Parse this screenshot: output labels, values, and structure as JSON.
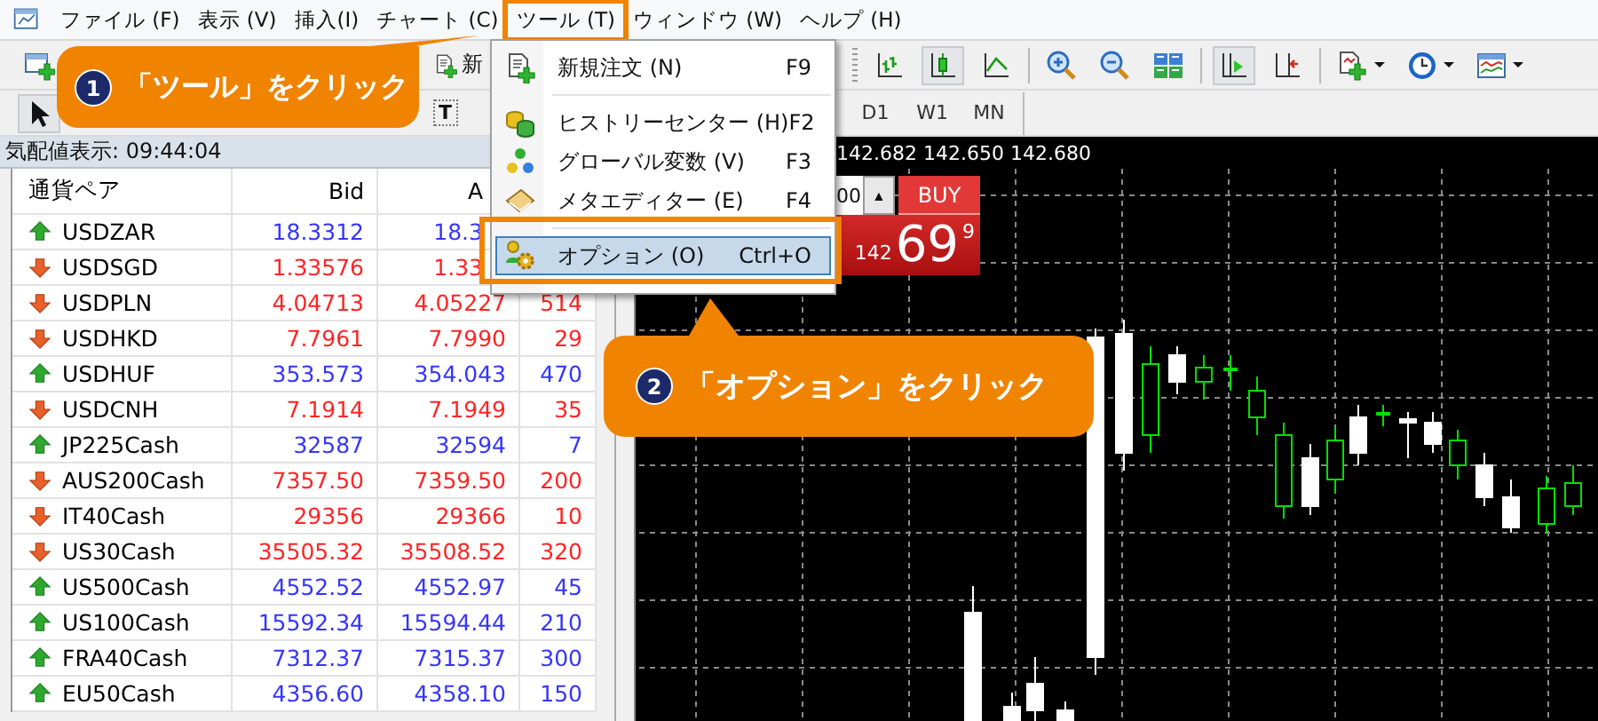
{
  "menubar": {
    "items": [
      {
        "label": "ファイル (F)",
        "highlighted": false
      },
      {
        "label": "表示 (V)",
        "highlighted": false
      },
      {
        "label": "挿入(I)",
        "highlighted": false
      },
      {
        "label": "チャート (C)",
        "highlighted": false
      },
      {
        "label": "ツール (T)",
        "highlighted": true
      },
      {
        "label": "ウィンドウ (W)",
        "highlighted": false
      },
      {
        "label": "ヘルプ (H)",
        "highlighted": false
      }
    ]
  },
  "toolbar": {
    "row1": [
      [
        {
          "kind": "new-chart",
          "pressed": false,
          "dropdown": false
        }
      ],
      [
        {
          "kind": "new-order",
          "pressed": false,
          "dropdown": false,
          "label": "新"
        }
      ],
      [
        {
          "kind": "grip"
        },
        {
          "kind": "bar-chart",
          "pressed": false,
          "dropdown": false
        },
        {
          "kind": "candle-chart",
          "pressed": true,
          "dropdown": false
        },
        {
          "kind": "line-chart",
          "pressed": false,
          "dropdown": false
        },
        {
          "kind": "separator"
        },
        {
          "kind": "zoom-in",
          "pressed": false,
          "dropdown": false
        },
        {
          "kind": "zoom-out",
          "pressed": false,
          "dropdown": false
        },
        {
          "kind": "tile",
          "pressed": false,
          "dropdown": false
        },
        {
          "kind": "separator"
        },
        {
          "kind": "autoscroll",
          "pressed": true,
          "dropdown": false
        },
        {
          "kind": "chart-shift",
          "pressed": false,
          "dropdown": false
        },
        {
          "kind": "separator"
        },
        {
          "kind": "indicator",
          "pressed": false,
          "dropdown": true
        },
        {
          "kind": "clock",
          "pressed": false,
          "dropdown": true
        },
        {
          "kind": "template",
          "pressed": false,
          "dropdown": true
        }
      ]
    ],
    "row2": [
      [
        {
          "kind": "cursor",
          "pressed": true,
          "dropdown": false
        }
      ],
      [
        {
          "kind": "text-tool",
          "pressed": false,
          "label": "T"
        }
      ],
      [
        {
          "kind": "timeframe",
          "label": "D1"
        },
        {
          "kind": "timeframe",
          "label": "W1"
        },
        {
          "kind": "timeframe",
          "label": "MN"
        }
      ]
    ]
  },
  "market_watch": {
    "title": "気配値表示: 09:44:04",
    "columns": [
      "通貨ペア",
      "Bid",
      "A"
    ],
    "rows": [
      {
        "symbol": "USDZAR",
        "rising": true,
        "bid": "18.3312",
        "ask": "18.3"
      },
      {
        "symbol": "USDSGD",
        "rising": false,
        "bid": "1.33576",
        "ask": "1.33"
      },
      {
        "symbol": "USDPLN",
        "rising": false,
        "bid": "4.04713",
        "ask": "4.05227",
        "spread": "514"
      },
      {
        "symbol": "USDHKD",
        "rising": false,
        "bid": "7.7961",
        "ask": "7.7990",
        "spread": "29"
      },
      {
        "symbol": "USDHUF",
        "rising": true,
        "bid": "353.573",
        "ask": "354.043",
        "spread": "470"
      },
      {
        "symbol": "USDCNH",
        "rising": false,
        "bid": "7.1914",
        "ask": "7.1949",
        "spread": "35"
      },
      {
        "symbol": "JP225Cash",
        "rising": true,
        "bid": "32587",
        "ask": "32594",
        "spread": "7"
      },
      {
        "symbol": "AUS200Cash",
        "rising": false,
        "bid": "7357.50",
        "ask": "7359.50",
        "spread": "200"
      },
      {
        "symbol": "IT40Cash",
        "rising": false,
        "bid": "29356",
        "ask": "29366",
        "spread": "10"
      },
      {
        "symbol": "US30Cash",
        "rising": false,
        "bid": "35505.32",
        "ask": "35508.52",
        "spread": "320"
      },
      {
        "symbol": "US500Cash",
        "rising": true,
        "bid": "4552.52",
        "ask": "4552.97",
        "spread": "45"
      },
      {
        "symbol": "US100Cash",
        "rising": true,
        "bid": "15592.34",
        "ask": "15594.44",
        "spread": "210"
      },
      {
        "symbol": "FRA40Cash",
        "rising": true,
        "bid": "7312.37",
        "ask": "7315.37",
        "spread": "300"
      },
      {
        "symbol": "EU50Cash",
        "rising": true,
        "bid": "4356.60",
        "ask": "4358.10",
        "spread": "150"
      }
    ]
  },
  "chart": {
    "prices": "142.682 142.650 142.680",
    "lot": "00",
    "spin": "▲",
    "buy": "BUY",
    "quote_prefix": "142",
    "quote_big": "69",
    "quote_pip": "9"
  },
  "tools_menu": {
    "items": [
      {
        "kind": "item",
        "label": "新規注文 (N)",
        "shortcut": "F9",
        "selected": false,
        "highlighted": false
      },
      {
        "kind": "separator"
      },
      {
        "kind": "item",
        "label": "ヒストリーセンター (H)",
        "shortcut": "F2",
        "selected": false,
        "highlighted": false
      },
      {
        "kind": "item",
        "label": "グローバル変数 (V)",
        "shortcut": "F3",
        "selected": false,
        "highlighted": false
      },
      {
        "kind": "item",
        "label": "メタエディター (E)",
        "shortcut": "F4",
        "selected": false,
        "highlighted": false
      },
      {
        "kind": "separator"
      },
      {
        "kind": "item",
        "label": "オプション (O)",
        "shortcut": "Ctrl+O",
        "selected": true,
        "highlighted": true
      }
    ]
  },
  "annotations": [
    {
      "step": "1",
      "text": "「ツール」をクリック"
    },
    {
      "step": "2",
      "text": "「オプション」をクリック"
    }
  ]
}
